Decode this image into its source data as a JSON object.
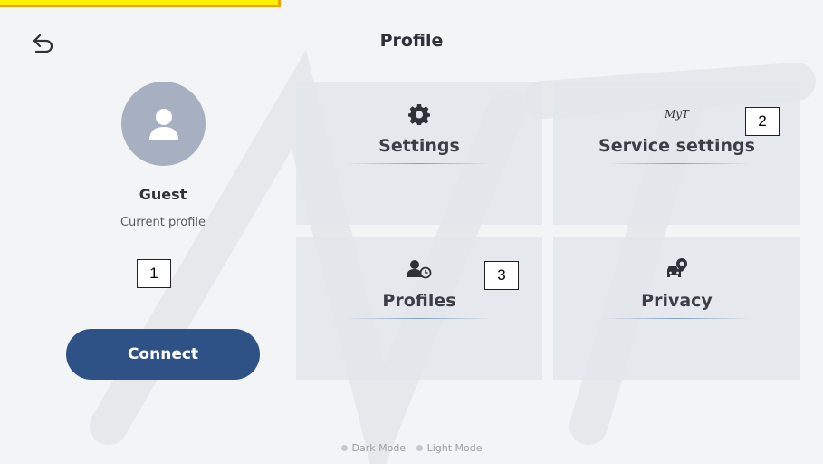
{
  "header": {
    "title": "Profile",
    "back_icon": "undo-arrow-icon"
  },
  "profile": {
    "name": "Guest",
    "subtitle": "Current profile",
    "avatar_icon": "person-icon"
  },
  "connect_label": "Connect",
  "tiles": [
    {
      "label": "Settings",
      "icon": "gear-icon"
    },
    {
      "label": "Service settings",
      "icon": "myt-logo-icon",
      "logo_text": "MyT"
    },
    {
      "label": "Profiles",
      "icon": "user-clock-icon"
    },
    {
      "label": "Privacy",
      "icon": "car-location-icon"
    }
  ],
  "annotations": [
    "1",
    "2",
    "3"
  ],
  "modes": [
    "Dark Mode",
    "Light Mode"
  ],
  "colors": {
    "accent": "#2f5286",
    "avatar_bg": "#a7b0c1",
    "tile_bg": "#e2e5ea",
    "highlight": "#fff200"
  }
}
